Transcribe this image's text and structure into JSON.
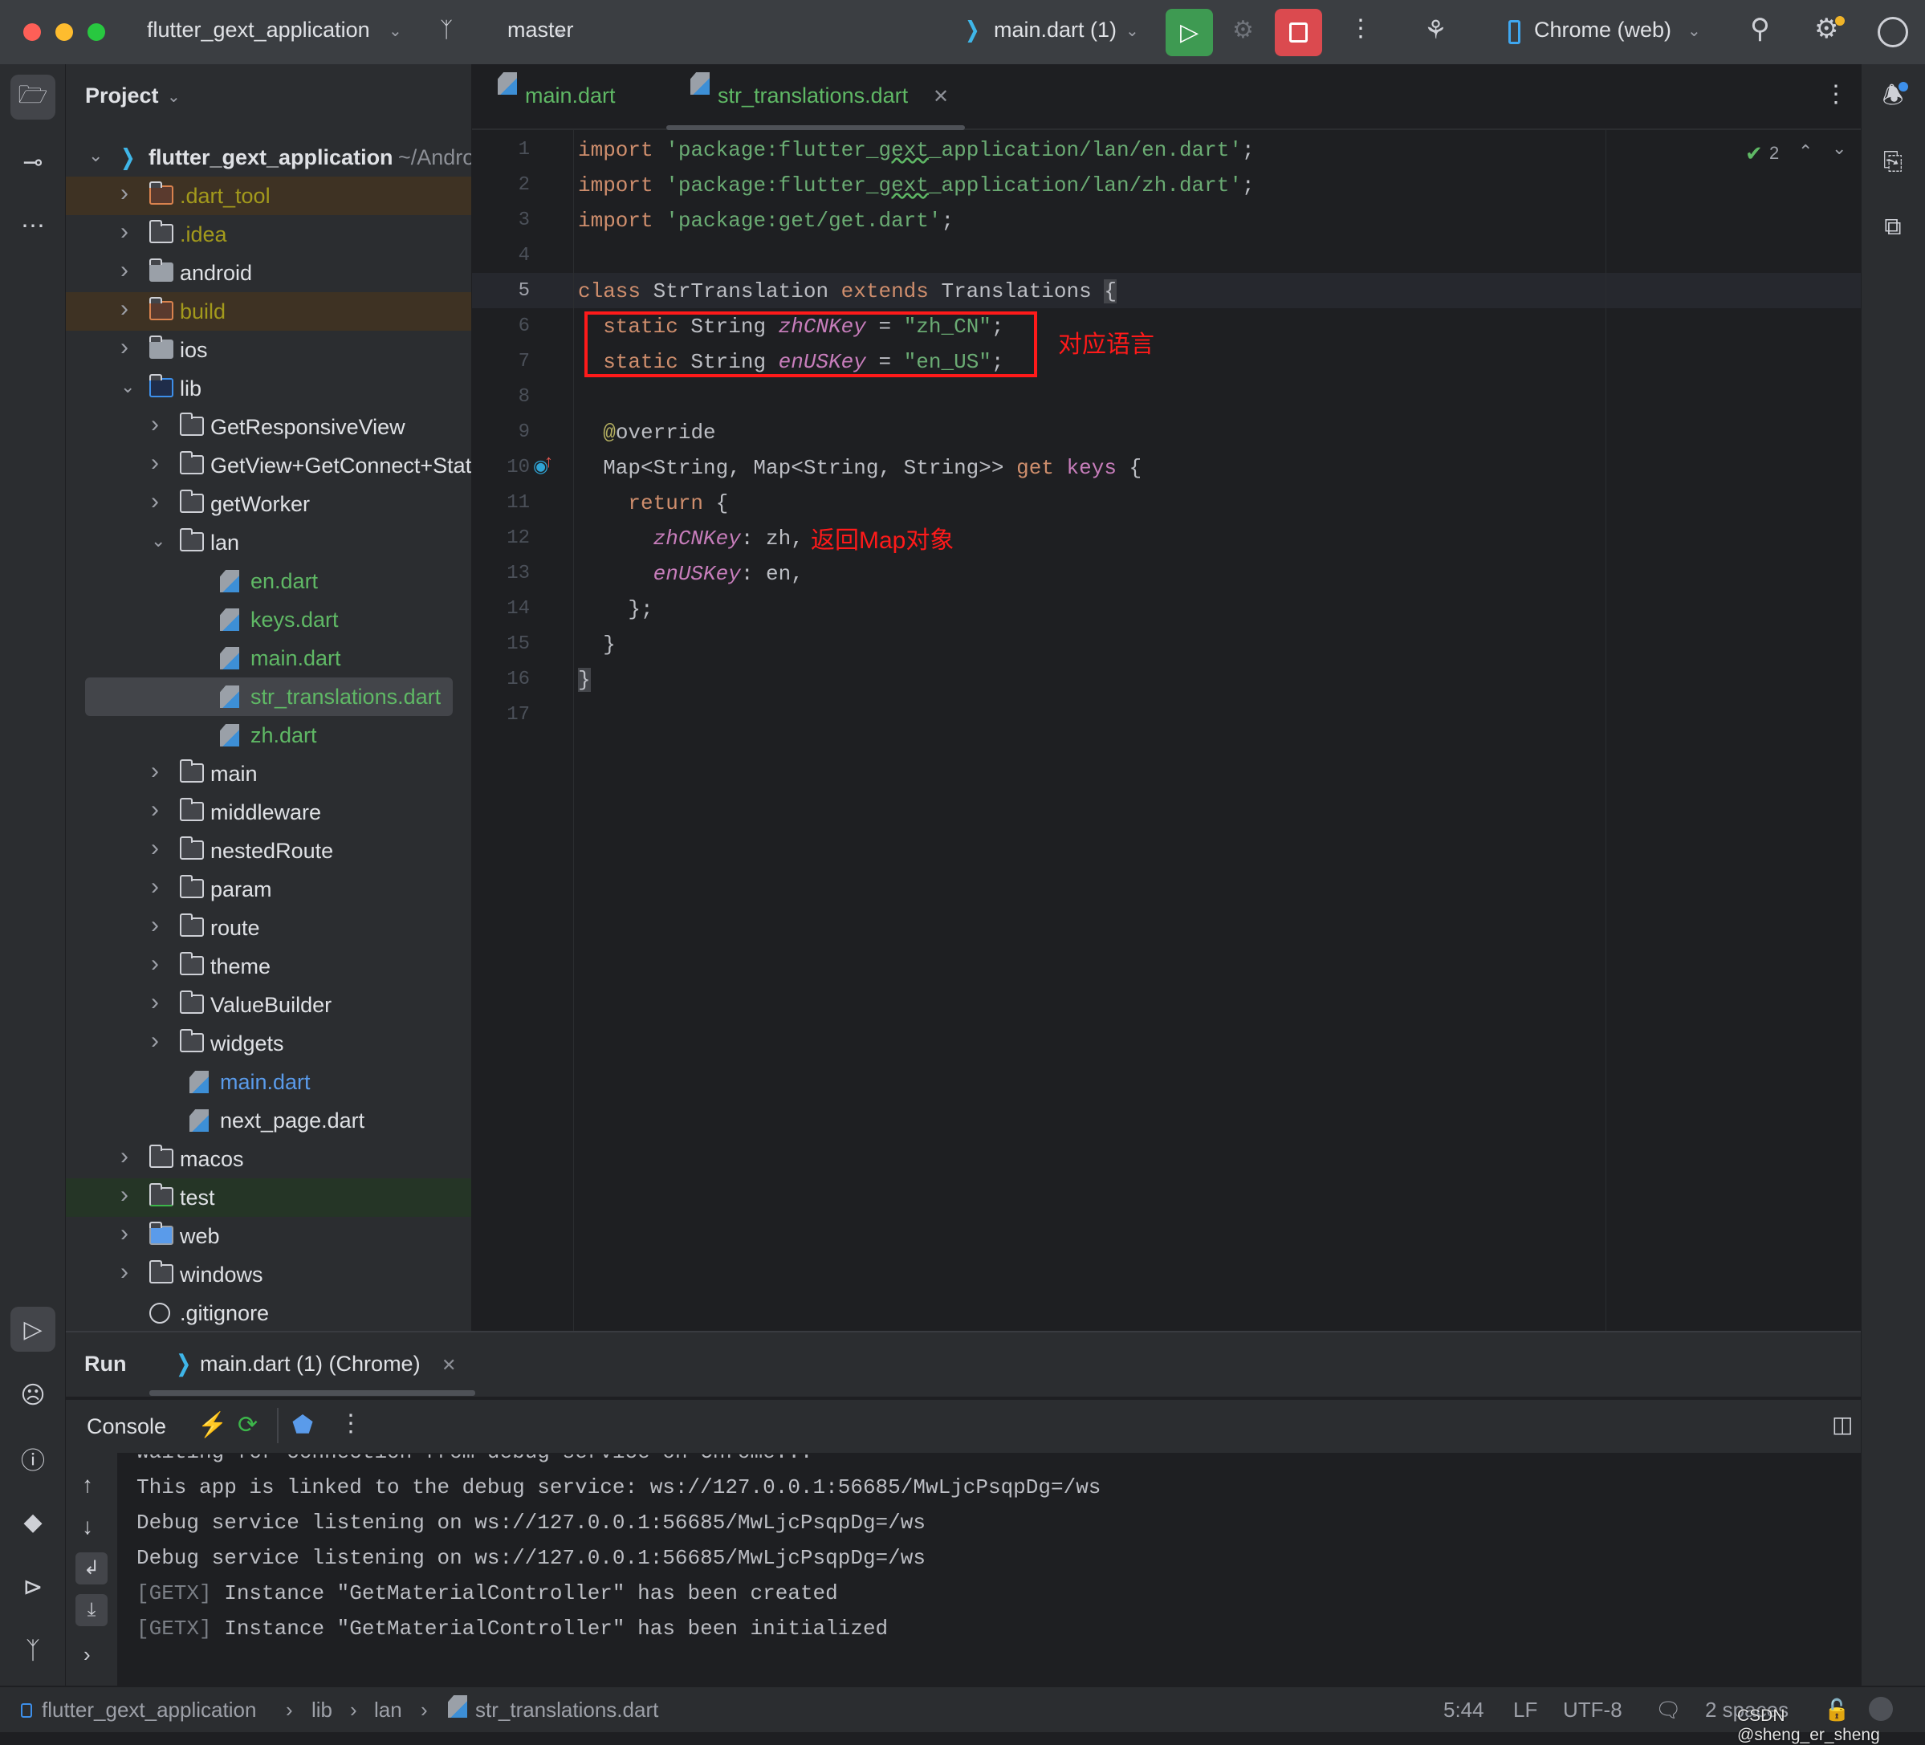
{
  "window": {
    "project_name": "flutter_gext_application",
    "branch": "master",
    "run_config": "main.dart (1)",
    "device": "Chrome (web)"
  },
  "colors": {
    "run_green": "#3e9a52",
    "stop_red": "#db4a4f",
    "annotation_red": "#ff1a1a",
    "selection": "#43454a"
  },
  "project": {
    "title": "Project",
    "root_name": "flutter_gext_application",
    "root_path": "~/Andro",
    "items": [
      {
        "label": ".dart_tool",
        "level": 1,
        "kind": "folder-excluded",
        "expanded": false,
        "color": "#a39a1c",
        "bg": "#3e3223"
      },
      {
        "label": ".idea",
        "level": 1,
        "kind": "folder-config",
        "expanded": false,
        "color": "#a39a1c"
      },
      {
        "label": "android",
        "level": 1,
        "kind": "folder-module",
        "expanded": false
      },
      {
        "label": "build",
        "level": 1,
        "kind": "folder-excluded",
        "expanded": false,
        "color": "#a39a1c",
        "bg": "#3e3223"
      },
      {
        "label": "ios",
        "level": 1,
        "kind": "folder-module",
        "expanded": false
      },
      {
        "label": "lib",
        "level": 1,
        "kind": "folder-source",
        "expanded": true
      },
      {
        "label": "GetResponsiveView",
        "level": 2,
        "kind": "folder",
        "expanded": false
      },
      {
        "label": "GetView+GetConnect+StateMixin",
        "level": 2,
        "kind": "folder",
        "expanded": false
      },
      {
        "label": "getWorker",
        "level": 2,
        "kind": "folder",
        "expanded": false
      },
      {
        "label": "lan",
        "level": 2,
        "kind": "folder",
        "expanded": true
      },
      {
        "label": "en.dart",
        "level": 3,
        "kind": "dart",
        "color": "#5fb865"
      },
      {
        "label": "keys.dart",
        "level": 3,
        "kind": "dart",
        "color": "#5fb865"
      },
      {
        "label": "main.dart",
        "level": 3,
        "kind": "dart",
        "color": "#5fb865"
      },
      {
        "label": "str_translations.dart",
        "level": 3,
        "kind": "dart",
        "color": "#5fb865",
        "selected": true
      },
      {
        "label": "zh.dart",
        "level": 3,
        "kind": "dart",
        "color": "#5fb865"
      },
      {
        "label": "main",
        "level": 2,
        "kind": "folder",
        "expanded": false
      },
      {
        "label": "middleware",
        "level": 2,
        "kind": "folder",
        "expanded": false
      },
      {
        "label": "nestedRoute",
        "level": 2,
        "kind": "folder",
        "expanded": false
      },
      {
        "label": "param",
        "level": 2,
        "kind": "folder",
        "expanded": false
      },
      {
        "label": "route",
        "level": 2,
        "kind": "folder",
        "expanded": false
      },
      {
        "label": "theme",
        "level": 2,
        "kind": "folder",
        "expanded": false
      },
      {
        "label": "ValueBuilder",
        "level": 2,
        "kind": "folder",
        "expanded": false
      },
      {
        "label": "widgets",
        "level": 2,
        "kind": "folder",
        "expanded": false
      },
      {
        "label": "main.dart",
        "level": 2,
        "kind": "dart",
        "color": "#5a9bea"
      },
      {
        "label": "next_page.dart",
        "level": 2,
        "kind": "dart"
      },
      {
        "label": "macos",
        "level": 1,
        "kind": "folder",
        "expanded": false
      },
      {
        "label": "test",
        "level": 1,
        "kind": "folder-test",
        "expanded": false,
        "bg": "#253526"
      },
      {
        "label": "web",
        "level": 1,
        "kind": "folder-web",
        "expanded": false
      },
      {
        "label": "windows",
        "level": 1,
        "kind": "folder",
        "expanded": false
      },
      {
        "label": ".gitignore",
        "level": 1,
        "kind": "ignore"
      }
    ]
  },
  "editor": {
    "tabs": [
      {
        "label": "main.dart",
        "active": false
      },
      {
        "label": "str_translations.dart",
        "active": true
      }
    ],
    "inspection_count": "2",
    "current_line": 5,
    "lines": [
      [
        [
          "import",
          "kw"
        ],
        [
          " ",
          ""
        ],
        [
          "'package:flutter_",
          "str"
        ],
        [
          "gext",
          "str un"
        ],
        [
          "_application/lan/en.dart'",
          "str"
        ],
        [
          ";",
          ""
        ]
      ],
      [
        [
          "import",
          "kw"
        ],
        [
          " ",
          ""
        ],
        [
          "'package:flutter_",
          "str"
        ],
        [
          "gext",
          "str un"
        ],
        [
          "_application/lan/zh.dart'",
          "str"
        ],
        [
          ";",
          ""
        ]
      ],
      [
        [
          "import",
          "kw"
        ],
        [
          " ",
          ""
        ],
        [
          "'package:get/get.dart'",
          "str"
        ],
        [
          ";",
          ""
        ]
      ],
      [],
      [
        [
          "class",
          "kw"
        ],
        [
          " StrTranslation ",
          ""
        ],
        [
          "extends",
          "kw"
        ],
        [
          " Translations ",
          ""
        ],
        [
          "{",
          "br"
        ]
      ],
      [
        [
          "  static",
          "kw"
        ],
        [
          " String ",
          ""
        ],
        [
          "zhCNKey",
          "pi"
        ],
        [
          " = ",
          ""
        ],
        [
          "\"zh_CN\"",
          "str"
        ],
        [
          ";",
          ""
        ]
      ],
      [
        [
          "  static",
          "kw"
        ],
        [
          " String ",
          ""
        ],
        [
          "enUSKey",
          "pi"
        ],
        [
          " = ",
          ""
        ],
        [
          "\"en_US\"",
          "str"
        ],
        [
          ";",
          ""
        ]
      ],
      [],
      [
        [
          "  ",
          ""
        ],
        [
          "@",
          "ann"
        ],
        [
          "override",
          ""
        ]
      ],
      [
        [
          "  Map<String, Map<String, String>> ",
          ""
        ],
        [
          "get",
          "kw"
        ],
        [
          " ",
          ""
        ],
        [
          "keys",
          "pu"
        ],
        [
          " {",
          ""
        ]
      ],
      [
        [
          "    return",
          "kw"
        ],
        [
          " {",
          ""
        ]
      ],
      [
        [
          "      ",
          ""
        ],
        [
          "zhCNKey",
          "pi"
        ],
        [
          ": zh,",
          ""
        ]
      ],
      [
        [
          "      ",
          ""
        ],
        [
          "enUSKey",
          "pi"
        ],
        [
          ": en,",
          ""
        ]
      ],
      [
        [
          "    };",
          ""
        ]
      ],
      [
        [
          "  }",
          ""
        ]
      ],
      [
        [
          "}",
          "br"
        ]
      ],
      []
    ],
    "annotations": {
      "box_label": "对应语言",
      "map_label": "返回Map对象"
    }
  },
  "run_panel": {
    "title": "Run",
    "tab_label": "main.dart (1) (Chrome)",
    "console_label": "Console",
    "output": [
      {
        "prefix": "",
        "text": "Waiting for connection from debug service on Chrome..."
      },
      {
        "prefix": "",
        "text": "This app is linked to the debug service: ws://127.0.0.1:56685/MwLjcPsqpDg=/ws"
      },
      {
        "prefix": "",
        "text": "Debug service listening on ws://127.0.0.1:56685/MwLjcPsqpDg=/ws"
      },
      {
        "prefix": "",
        "text": "Debug service listening on ws://127.0.0.1:56685/MwLjcPsqpDg=/ws"
      },
      {
        "prefix": "[GETX]",
        "text": " Instance \"GetMaterialController\" has been created"
      },
      {
        "prefix": "[GETX]",
        "text": " Instance \"GetMaterialController\" has been initialized"
      }
    ]
  },
  "status_bar": {
    "breadcrumb": [
      "flutter_gext_application",
      "lib",
      "lan",
      "str_translations.dart"
    ],
    "position": "5:44",
    "line_ending": "LF",
    "encoding": "UTF-8",
    "indent": "2 spaces",
    "watermark": "CSDN @sheng_er_sheng"
  }
}
